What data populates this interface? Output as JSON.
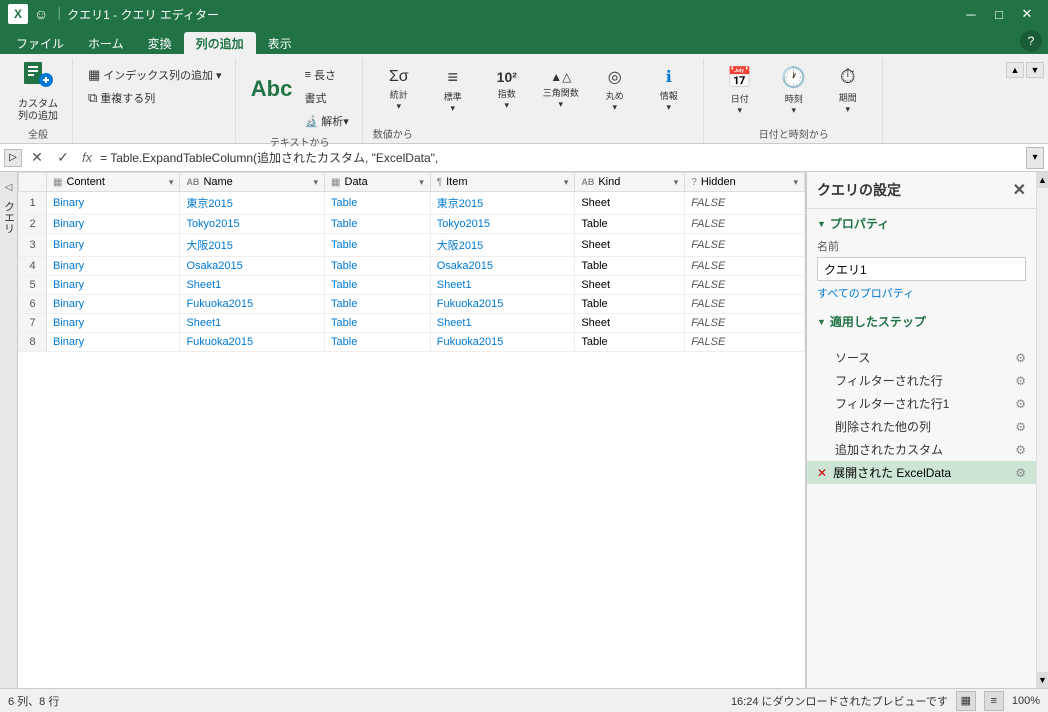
{
  "titleBar": {
    "logo": "X",
    "smile": "☺",
    "separator": "│",
    "title": "クエリ1 - クエリ エディター",
    "minimize": "─",
    "maximize": "□",
    "close": "✕"
  },
  "ribbonTabs": {
    "tabs": [
      "ファイル",
      "ホーム",
      "変換",
      "列の追加",
      "表示"
    ],
    "activeTab": "列の追加",
    "help": "?"
  },
  "ribbonGroups": [
    {
      "id": "custom-col",
      "label": "全般",
      "buttons": [
        {
          "id": "add-custom-col",
          "icon": "📊",
          "label": "カスタム\n列の追加"
        }
      ]
    },
    {
      "id": "index",
      "label": "",
      "buttons": [
        {
          "id": "add-index",
          "icon": "▦",
          "label": "インデックス列の追加 ▾"
        },
        {
          "id": "duplicate",
          "icon": "⧉",
          "label": "重複する列"
        }
      ]
    },
    {
      "id": "text-from",
      "label": "テキストから",
      "buttons": [
        {
          "id": "format-abc",
          "icon": "Abc",
          "label": ""
        },
        {
          "id": "length",
          "icon": "≡",
          "label": "長さ"
        },
        {
          "id": "format-small",
          "icon": "書\n式",
          "label": ""
        },
        {
          "id": "extract",
          "icon": "🔬",
          "label": "解析▾"
        }
      ]
    },
    {
      "id": "num-from",
      "label": "数値から",
      "buttons": [
        {
          "id": "stats",
          "icon": "Σσ",
          "label": "統計▾"
        },
        {
          "id": "standard",
          "icon": "≡",
          "label": "標準▾"
        },
        {
          "id": "exp",
          "icon": "10²",
          "label": "指数▾"
        },
        {
          "id": "trig",
          "icon": "▲△",
          "label": "三角関数▾"
        },
        {
          "id": "round",
          "icon": "◎",
          "label": "丸め▾"
        },
        {
          "id": "info",
          "icon": "ℹ",
          "label": "情報▾"
        }
      ]
    },
    {
      "id": "date-from",
      "label": "日付と時刻から",
      "buttons": [
        {
          "id": "date",
          "icon": "📅",
          "label": "日付▾"
        },
        {
          "id": "time",
          "icon": "🕐",
          "label": "時刻▾"
        },
        {
          "id": "duration",
          "icon": "⏱",
          "label": "期間▾"
        }
      ]
    }
  ],
  "formulaBar": {
    "cancelSymbol": "✕",
    "confirmSymbol": "✓",
    "fxLabel": "fx",
    "formula": "= Table.ExpandTableColumn(追加されたカスタム, \"ExcelData\",",
    "dropdownSymbol": "▾"
  },
  "sidebarToggle": {
    "label": "クエリ"
  },
  "table": {
    "columns": [
      {
        "id": "content",
        "icon": "▦",
        "label": "Content",
        "filter": "▾"
      },
      {
        "id": "name",
        "icon": "AB",
        "label": "Name",
        "filter": "▾"
      },
      {
        "id": "data",
        "icon": "▦",
        "label": "Data",
        "filter": "▾"
      },
      {
        "id": "item",
        "icon": "¶",
        "label": "Item",
        "filter": "▾"
      },
      {
        "id": "kind",
        "icon": "AB",
        "label": "Kind",
        "filter": "▾"
      },
      {
        "id": "hidden",
        "icon": "?",
        "label": "Hidden",
        "filter": "▾"
      }
    ],
    "rows": [
      {
        "num": 1,
        "content": "Binary",
        "name": "東京2015",
        "data": "Table",
        "item": "東京2015",
        "kind": "Sheet",
        "hidden": "FALSE"
      },
      {
        "num": 2,
        "content": "Binary",
        "name": "Tokyo2015",
        "data": "Table",
        "item": "Tokyo2015",
        "kind": "Table",
        "hidden": "FALSE"
      },
      {
        "num": 3,
        "content": "Binary",
        "name": "大阪2015",
        "data": "Table",
        "item": "大阪2015",
        "kind": "Sheet",
        "hidden": "FALSE"
      },
      {
        "num": 4,
        "content": "Binary",
        "name": "Osaka2015",
        "data": "Table",
        "item": "Osaka2015",
        "kind": "Table",
        "hidden": "FALSE"
      },
      {
        "num": 5,
        "content": "Binary",
        "name": "Sheet1",
        "data": "Table",
        "item": "Sheet1",
        "kind": "Sheet",
        "hidden": "FALSE"
      },
      {
        "num": 6,
        "content": "Binary",
        "name": "Fukuoka2015",
        "data": "Table",
        "item": "Fukuoka2015",
        "kind": "Table",
        "hidden": "FALSE"
      },
      {
        "num": 7,
        "content": "Binary",
        "name": "Sheet1",
        "data": "Table",
        "item": "Sheet1",
        "kind": "Sheet",
        "hidden": "FALSE"
      },
      {
        "num": 8,
        "content": "Binary",
        "name": "Fukuoka2015",
        "data": "Table",
        "item": "Fukuoka2015",
        "kind": "Table",
        "hidden": "FALSE"
      }
    ]
  },
  "queryPanel": {
    "title": "クエリの設定",
    "closeIcon": "✕",
    "propertiesSection": "プロパティ",
    "nameLabel": "名前",
    "queryName": "クエリ1",
    "allPropsLink": "すべてのプロパティ",
    "stepsSection": "適用したステップ",
    "steps": [
      {
        "id": "source",
        "label": "ソース",
        "hasGear": true,
        "isError": false,
        "isActive": false
      },
      {
        "id": "filtered-rows",
        "label": "フィルターされた行",
        "hasGear": true,
        "isError": false,
        "isActive": false
      },
      {
        "id": "filtered-rows1",
        "label": "フィルターされた行1",
        "hasGear": true,
        "isError": false,
        "isActive": false
      },
      {
        "id": "removed-cols",
        "label": "削除された他の列",
        "hasGear": true,
        "isError": false,
        "isActive": false
      },
      {
        "id": "added-custom",
        "label": "追加されたカスタム",
        "hasGear": true,
        "isError": false,
        "isActive": false
      },
      {
        "id": "expanded-excel",
        "label": "展開された ExcelData",
        "hasGear": true,
        "isError": false,
        "isActive": true
      }
    ]
  },
  "statusBar": {
    "left": "6 列、8 行",
    "right": "16:24 にダウンロードされたプレビューです",
    "gridIcon": "▦",
    "barIcon": "≡",
    "zoom": "100%"
  }
}
